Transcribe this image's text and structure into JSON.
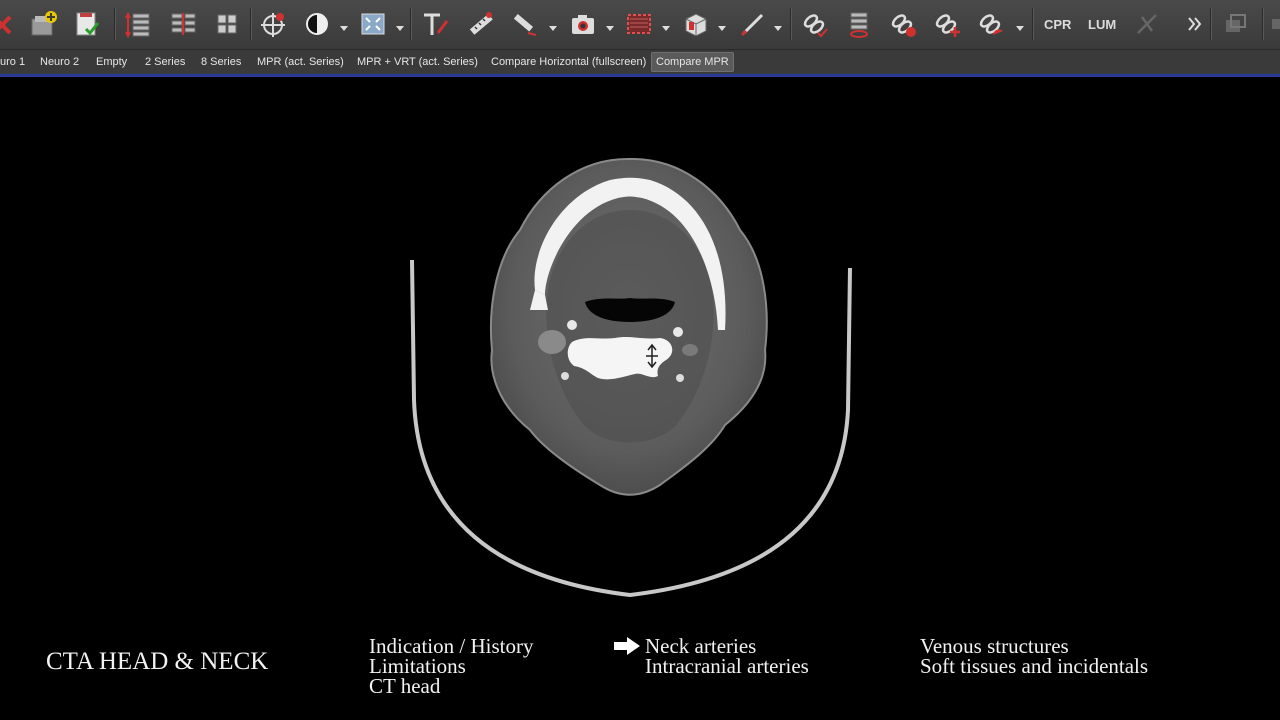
{
  "toolbar": {
    "icons": [
      "close-icon",
      "series-add-icon",
      "report-check-icon",
      "stack-scroll-icon",
      "stack-link-icon",
      "grid-layout-icon",
      "crosshair-icon",
      "contrast-icon",
      "fit-window-icon",
      "text-annotation-icon",
      "measure-ruler-icon",
      "angle-measure-icon",
      "camera-icon",
      "roi-box-icon",
      "cube-3d-icon",
      "pen-icon",
      "link-check-icon",
      "stack-red-icon",
      "link-r-icon",
      "link-add-icon",
      "link-palette-icon"
    ],
    "cpr_label": "CPR",
    "lum_label": "LUM",
    "overflow_icon": "double-chevron-right-icon"
  },
  "layout_tabs": [
    {
      "label": "uro 1"
    },
    {
      "label": "Neuro 2"
    },
    {
      "label": "Empty"
    },
    {
      "label": "2 Series"
    },
    {
      "label": "8 Series"
    },
    {
      "label": "MPR (act. Series)"
    },
    {
      "label": "MPR + VRT (act. Series)"
    },
    {
      "label": "Compare Horizontal (fullscreen)"
    },
    {
      "label": "Compare MPR",
      "active": true
    }
  ],
  "captions": {
    "title": "CTA HEAD & NECK",
    "col1": [
      "Indication / History",
      "Limitations",
      "CT head"
    ],
    "col2": [
      "Neck arteries",
      "Intracranial arteries"
    ],
    "col3": [
      "Venous structures",
      "Soft tissues and incidentals"
    ],
    "current_item": "Neck arteries"
  },
  "colors": {
    "accent": "#2b3a96",
    "toolbar_bg": "#404040"
  }
}
